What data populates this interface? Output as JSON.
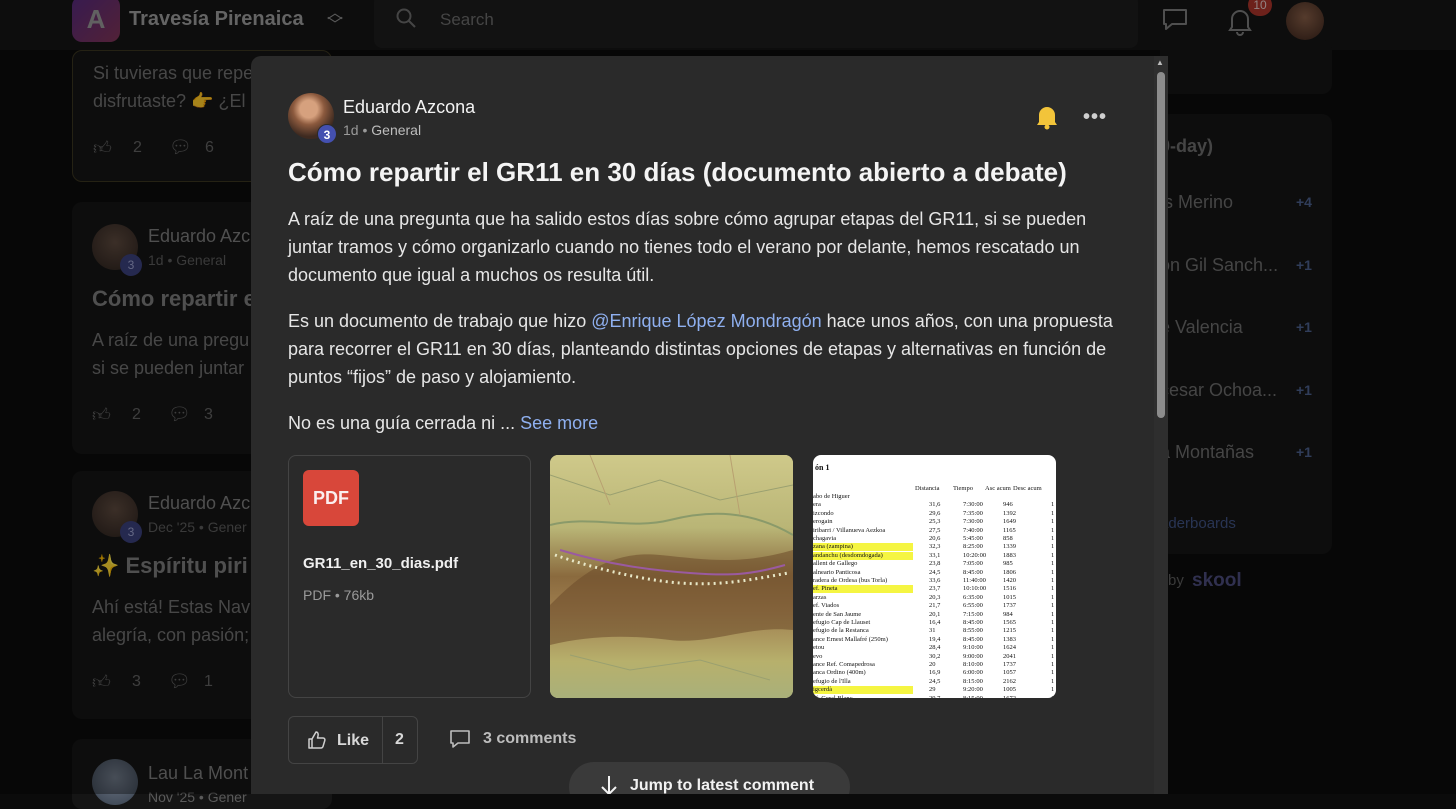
{
  "header": {
    "group_name": "Travesía Pirenaica",
    "search_placeholder": "Search",
    "notification_count": "10"
  },
  "background_feed": {
    "card1": {
      "line1": "Si tuvieras que repe",
      "line2": "disfrutaste? 👉 ¿El",
      "likes": "2",
      "comments": "6"
    },
    "card2": {
      "author": "Eduardo Azc",
      "meta": "1d • General",
      "level": "3",
      "title": "Cómo repartir e",
      "line1": "A raíz de una pregu",
      "line2": "si se pueden juntar",
      "likes": "2",
      "comments": "3"
    },
    "card3": {
      "author": "Eduardo Azc",
      "meta": "Dec '25 • Gener",
      "level": "3",
      "title": "✨ Espíritu piri",
      "line1": "Ahí está! Estas Nav",
      "line2": "alegría, con pasión;",
      "likes": "3",
      "comments": "1"
    },
    "card4": {
      "author": "Lau La Mont",
      "meta": "Nov '25 • Gener"
    }
  },
  "leaderboard": {
    "title": "0-day)",
    "entries": [
      {
        "name": "is Merino",
        "points": "+4"
      },
      {
        "name": "on Gil Sanch...",
        "points": "+1"
      },
      {
        "name": "e Valencia",
        "points": "+1"
      },
      {
        "name": "cesar Ochoa...",
        "points": "+1"
      },
      {
        "name": "a Montañas",
        "points": "+1"
      }
    ],
    "link": "aderboards",
    "powered_by": "by",
    "brand": "skool"
  },
  "post": {
    "author": "Eduardo Azcona",
    "level": "3",
    "time": "1d",
    "separator": " • ",
    "category": "General",
    "title": "Cómo repartir el GR11 en 30 días (documento abierto a debate)",
    "paragraph1": "A raíz de una pregunta que ha salido estos días sobre cómo agrupar etapas del GR11, si se pueden juntar tramos y cómo organizarlo cuando no tienes todo el verano por delante, hemos rescatado un documento que igual a muchos os resulta útil.",
    "paragraph2_before": "Es un documento de trabajo que hizo ",
    "mention": "@Enrique López Mondragón",
    "paragraph2_after": " hace unos años, con una propuesta para recorrer el GR11 en 30 días, planteando distintas opciones de etapas y alternativas en función de puntos “fijos” de paso y alojamiento.",
    "paragraph3": "No es una guía cerrada ni ... ",
    "see_more": "See more",
    "attachment": {
      "icon_label": "PDF",
      "file_name": "GR11_en_30_dias.pdf",
      "file_info": "PDF • 76kb"
    },
    "table_preview": {
      "title": "ón 1",
      "headers": [
        "Distancia",
        "Tiempo",
        "Asc acum",
        "Desc acum"
      ],
      "rows": [
        {
          "name": "abo de Higuer",
          "d": "",
          "t": "",
          "a": "",
          "hl": false
        },
        {
          "name": "era",
          "d": "31,6",
          "t": "7:30:00",
          "a": "946",
          "hl": false
        },
        {
          "name": "izcondo",
          "d": "29,6",
          "t": "7:35:00",
          "a": "1392",
          "hl": false
        },
        {
          "name": "erogain",
          "d": "25,3",
          "t": "7:30:00",
          "a": "1649",
          "hl": false
        },
        {
          "name": "iribarri / Villanueva Aezkoa",
          "d": "27,5",
          "t": "7:40:00",
          "a": "1165",
          "hl": false
        },
        {
          "name": "chagavia",
          "d": "20,6",
          "t": "5:45:00",
          "a": "858",
          "hl": false
        },
        {
          "name": "zana (zampina)",
          "d": "32,3",
          "t": "8:25:00",
          "a": "1339",
          "hl": true
        },
        {
          "name": "andanchu (desdomdogada)",
          "d": "33,1",
          "t": "10:20:00",
          "a": "1883",
          "hl": true
        },
        {
          "name": "allent de Gallego",
          "d": "23,8",
          "t": "7:05:00",
          "a": "985",
          "hl": false
        },
        {
          "name": "alneario Panticosa",
          "d": "24,5",
          "t": "8:45:00",
          "a": "1806",
          "hl": false
        },
        {
          "name": "radera de Ordesa (bus Torla)",
          "d": "33,6",
          "t": "11:40:00",
          "a": "1420",
          "hl": false
        },
        {
          "name": "ef. Pineta",
          "d": "23,7",
          "t": "10:10:00",
          "a": "1516",
          "hl": true
        },
        {
          "name": "arzas",
          "d": "20,3",
          "t": "6:35:00",
          "a": "1015",
          "hl": false
        },
        {
          "name": "ef. Viados",
          "d": "21,7",
          "t": "6:55:00",
          "a": "1737",
          "hl": false
        },
        {
          "name": "ente de San Jaume",
          "d": "20,1",
          "t": "7:15:00",
          "a": "984",
          "hl": false
        },
        {
          "name": "efugio Cap de Llauset",
          "d": "16,4",
          "t": "8:45:00",
          "a": "1565",
          "hl": false
        },
        {
          "name": "efugio de la Restanca",
          "d": "31",
          "t": "8:55:00",
          "a": "1215",
          "hl": false
        },
        {
          "name": "ance Ernest Mallafré (250m)",
          "d": "19,4",
          "t": "8:45:00",
          "a": "1383",
          "hl": false
        },
        {
          "name": "etou",
          "d": "28,4",
          "t": "9:10:00",
          "a": "1624",
          "hl": false
        },
        {
          "name": "evo",
          "d": "30,2",
          "t": "9:00:00",
          "a": "2041",
          "hl": false
        },
        {
          "name": "ance Ref. Comapedrosa",
          "d": "20",
          "t": "8:10:00",
          "a": "1737",
          "hl": false
        },
        {
          "name": "anca Ordino (400m)",
          "d": "16,9",
          "t": "6:00:00",
          "a": "1057",
          "hl": false
        },
        {
          "name": "efugio de l'Illa",
          "d": "24,5",
          "t": "8:15:00",
          "a": "2162",
          "hl": false
        },
        {
          "name": "igcerdà",
          "d": "29",
          "t": "9:20:00",
          "a": "1005",
          "hl": true
        },
        {
          "name": "ef. Coral Blanc",
          "d": "29,7",
          "t": "8:15:00",
          "a": "1672",
          "hl": false
        },
        {
          "name": "ef Ulldeter",
          "d": "26,3",
          "t": "10:10:00",
          "a": "2016",
          "hl": false
        }
      ]
    },
    "like_label": "Like",
    "like_count": "2",
    "comments_label": "3 comments",
    "jump_label": "Jump to latest comment"
  }
}
